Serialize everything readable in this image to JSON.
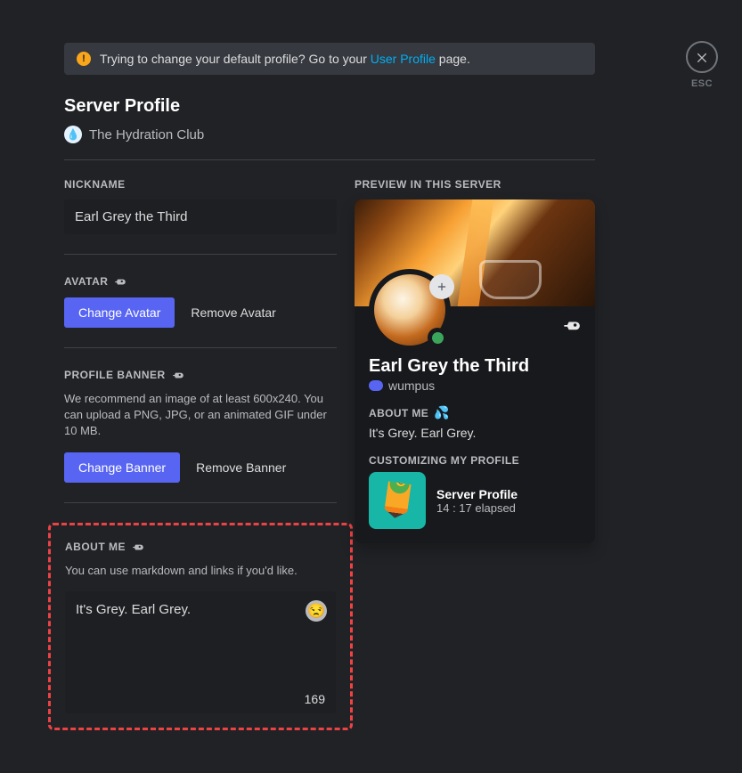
{
  "esc_label": "ESC",
  "notice": {
    "prefix": "Trying to change your default profile? Go to your ",
    "link_text": "User Profile",
    "suffix": " page."
  },
  "page_title": "Server Profile",
  "server_name": "The Hydration Club",
  "nickname": {
    "label": "NICKNAME",
    "value": "Earl Grey the Third"
  },
  "avatar": {
    "label": "AVATAR",
    "change": "Change Avatar",
    "remove": "Remove Avatar"
  },
  "banner": {
    "label": "PROFILE BANNER",
    "helper": "We recommend an image of at least 600x240. You can upload a PNG, JPG, or an animated GIF under 10 MB.",
    "change": "Change Banner",
    "remove": "Remove Banner"
  },
  "about": {
    "label": "ABOUT ME",
    "helper": "You can use markdown and links if you'd like.",
    "value": "It's Grey. Earl Grey.",
    "char_count": "169"
  },
  "preview": {
    "label": "PREVIEW IN THIS SERVER",
    "name": "Earl Grey the Third",
    "handle": "wumpus",
    "about_label": "ABOUT ME",
    "about_text": "It's Grey. Earl Grey.",
    "activity_label": "CUSTOMIZING MY PROFILE",
    "activity_title": "Server Profile",
    "activity_sub": "14 : 17 elapsed"
  }
}
